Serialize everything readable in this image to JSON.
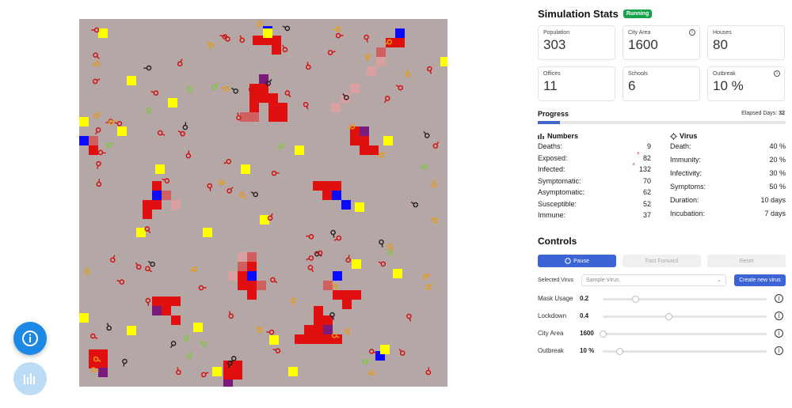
{
  "stats": {
    "title": "Simulation Stats",
    "status_badge": "Running",
    "cards": [
      {
        "label": "Population",
        "value": "303",
        "info": false
      },
      {
        "label": "City Area",
        "value": "1600",
        "info": true
      },
      {
        "label": "Houses",
        "value": "80",
        "info": false
      },
      {
        "label": "Offices",
        "value": "11",
        "info": false
      },
      {
        "label": "Schools",
        "value": "6",
        "info": false
      },
      {
        "label": "Outbreak",
        "value": "10 %",
        "info": true
      }
    ]
  },
  "progress": {
    "title": "Progress",
    "elapsed_label": "Elapsed Days:",
    "elapsed_value": "32",
    "fraction": 0.09
  },
  "numbers": {
    "title": "Numbers",
    "rows": [
      {
        "label": "Deaths:",
        "value": "9",
        "trend": ""
      },
      {
        "label": "Exposed:",
        "value": "82",
        "trend": "up"
      },
      {
        "label": "Infected:",
        "value": "132",
        "trend": "up"
      },
      {
        "label": "Symptomatic:",
        "value": "70",
        "trend": ""
      },
      {
        "label": "Asymptomatic:",
        "value": "62",
        "trend": ""
      },
      {
        "label": "Susceptible:",
        "value": "52",
        "trend": ""
      },
      {
        "label": "Immune:",
        "value": "37",
        "trend": ""
      }
    ]
  },
  "virus": {
    "title": "Virus",
    "rows": [
      {
        "label": "Death:",
        "value": "40 %"
      },
      {
        "label": "Immunity:",
        "value": "20 %"
      },
      {
        "label": "Infectivity:",
        "value": "30 %"
      },
      {
        "label": "Symptoms:",
        "value": "50 %"
      },
      {
        "label": "Duration:",
        "value": "10 days"
      },
      {
        "label": "Incubation:",
        "value": "7 days"
      }
    ]
  },
  "controls": {
    "title": "Controls",
    "pause_label": "Pause",
    "fast_forward_label": "Fast Forward",
    "reset_label": "Reset",
    "selected_virus_label": "Selected Virus",
    "selected_virus_value": "Sample Virus",
    "create_virus_label": "Create new virus",
    "sliders": [
      {
        "label": "Mask Usage",
        "value": "0.2",
        "fraction": 0.2
      },
      {
        "label": "Lockdown",
        "value": "0.4",
        "fraction": 0.4
      },
      {
        "label": "City Area",
        "value": "1600",
        "fraction": 0.0
      },
      {
        "label": "Outbreak",
        "value": "10 %",
        "fraction": 0.1
      }
    ]
  },
  "colors": {
    "accent": "#3c64d4",
    "running": "#16a34a",
    "grid_bg": "#b6a7a7",
    "infected_cell": "#e01010",
    "exposed_cell": "#d06060",
    "recovered_cell": "#d8a0a0",
    "house_cell": "#ffff00",
    "office_cell": "#0a0aff",
    "dead_cell": "#7a1a7a"
  },
  "icons": {
    "info_fab": "info-icon",
    "chart_fab": "bar-chart-icon",
    "numbers": "bar-chart-icon",
    "virus": "virus-icon",
    "pause": "pause-circle-icon"
  }
}
